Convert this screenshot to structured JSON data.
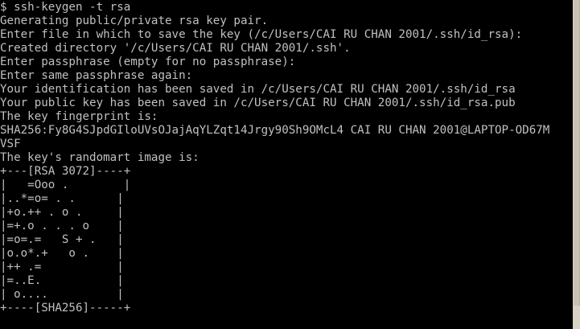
{
  "terminal": {
    "foreground": "#c0c0c0",
    "background": "#000000",
    "lines": [
      "$ ssh-keygen -t rsa",
      "Generating public/private rsa key pair.",
      "Enter file in which to save the key (/c/Users/CAI RU CHAN 2001/.ssh/id_rsa):",
      "Created directory '/c/Users/CAI RU CHAN 2001/.ssh'.",
      "Enter passphrase (empty for no passphrase):",
      "Enter same passphrase again:",
      "Your identification has been saved in /c/Users/CAI RU CHAN 2001/.ssh/id_rsa",
      "Your public key has been saved in /c/Users/CAI RU CHAN 2001/.ssh/id_rsa.pub",
      "The key fingerprint is:",
      "SHA256:Fy8G4SJpdGIloUVsOJajAqYLZqt14Jrgy90Sh9OMcL4 CAI RU CHAN 2001@LAPTOP-OD67M",
      "VSF",
      "The key's randomart image is:",
      "+---[RSA 3072]----+",
      "|   =Ooo .        |",
      "|..*=o= . .      |",
      "|+o.++ . o .     |",
      "|=+.o . . . o    |",
      "|=o=.=   S + .   |",
      "|o.o*.+   o .    |",
      "|++ .=           |",
      "|=..E.           |",
      "| o....          |",
      "+----[SHA256]-----+"
    ]
  },
  "scrollbar": {
    "track_color": "#d8d2c4",
    "thumb_color": "#c9c2b2"
  }
}
